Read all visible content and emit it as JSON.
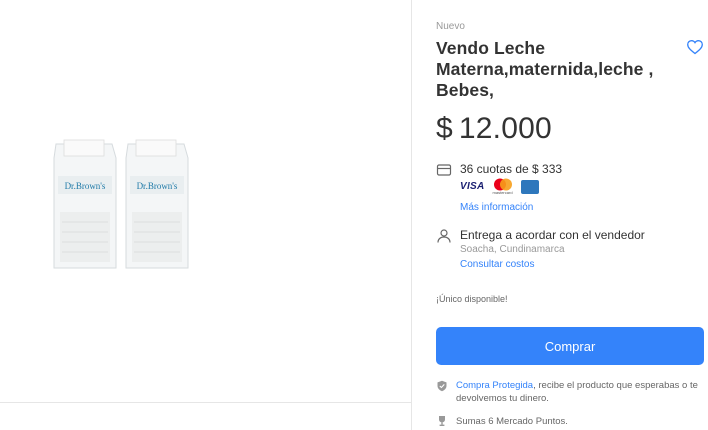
{
  "product": {
    "condition": "Nuevo",
    "title": "Vendo Leche Materna,maternida,leche , Bebes,",
    "price_symbol": "$",
    "price_value": "12.000",
    "image_brand": "Dr.Brown's"
  },
  "payment": {
    "installments": "36 cuotas de $ 333",
    "card_visa": "VISA",
    "card_mastercard": "mastercard",
    "more_info_link": "Más información"
  },
  "shipping": {
    "title": "Entrega a acordar con el vendedor",
    "location": "Soacha, Cundinamarca",
    "costs_link": "Consultar costos"
  },
  "stock": {
    "label": "¡Único disponible!"
  },
  "actions": {
    "buy_label": "Comprar"
  },
  "protection": {
    "link": "Compra Protegida",
    "text": ", recibe el producto que esperabas o te devolvemos tu dinero."
  },
  "points": {
    "text": "Sumas 6 Mercado Puntos."
  },
  "colors": {
    "accent": "#3483fa",
    "text": "#333333",
    "muted": "#999999"
  }
}
